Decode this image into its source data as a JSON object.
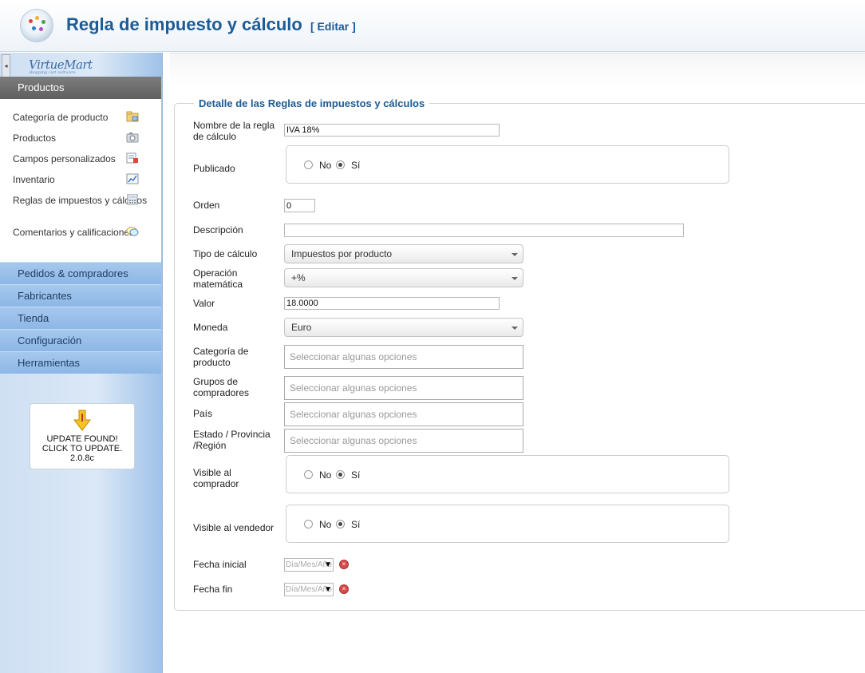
{
  "header": {
    "title": "Regla de impuesto y cálculo",
    "edit_tag": "[ Editar ]"
  },
  "sidebar": {
    "brand": "VirtueMart",
    "brand_tagline": "shopping cart software",
    "active_section": "Productos",
    "product_items": [
      {
        "label": "Categoría de producto",
        "icon": "category-folder-icon"
      },
      {
        "label": "Productos",
        "icon": "camera-icon"
      },
      {
        "label": "Campos personalizados",
        "icon": "custom-fields-icon"
      },
      {
        "label": "Inventario",
        "icon": "chart-icon"
      },
      {
        "label": "Reglas de impuestos y cálculos",
        "icon": "calculator-icon"
      },
      {
        "label": "Comentarios y calificaciones",
        "icon": "speech-bubble-icon"
      }
    ],
    "sections": [
      "Pedidos & compradores",
      "Fabricantes",
      "Tienda",
      "Configuración",
      "Herramientas"
    ],
    "update": {
      "line1": "UPDATE FOUND!",
      "line2": "CLICK TO UPDATE.",
      "version": "2.0.8c"
    }
  },
  "form": {
    "legend": "Detalle de las Reglas de impuestos y cálculos",
    "labels": {
      "name": "Nombre de la regla de cálculo",
      "published": "Publicado",
      "order": "Orden",
      "description": "Descripción",
      "calc_type": "Tipo de cálculo",
      "math_op": "Operación matemática",
      "value": "Valor",
      "currency": "Moneda",
      "category": "Categoría de producto",
      "groups": "Grupos de compradores",
      "country": "País",
      "state": "Estado / Provincia /Región",
      "visible_buyer": "Visible al comprador",
      "visible_vendor": "Visible al vendedor",
      "start_date": "Fecha inicial",
      "end_date": "Fecha fin"
    },
    "values": {
      "name": "IVA 18%",
      "order": "0",
      "description": "",
      "calc_type": "Impuestos por producto",
      "math_op": "+%",
      "value": "18.0000",
      "currency": "Euro",
      "date_placeholder": "Día/Mes/Año"
    },
    "radio": {
      "no": "No",
      "yes": "Sí"
    },
    "chosen_placeholder": "Seleccionar algunas opciones"
  }
}
